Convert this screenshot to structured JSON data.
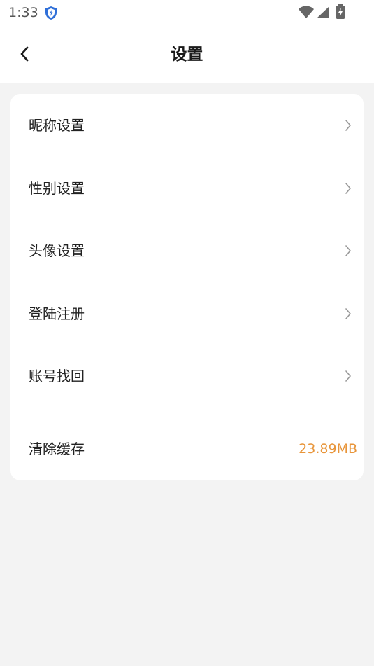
{
  "status_bar": {
    "time": "1:33",
    "icons": [
      "shield-icon",
      "wifi-icon",
      "signal-icon",
      "battery-icon"
    ]
  },
  "header": {
    "back_icon": "chevron-left-icon",
    "title": "设置"
  },
  "settings": {
    "items": [
      {
        "label": "昵称设置",
        "icon": "chevron-right-icon"
      },
      {
        "label": "性别设置",
        "icon": "chevron-right-icon"
      },
      {
        "label": "头像设置",
        "icon": "chevron-right-icon"
      },
      {
        "label": "登陆注册",
        "icon": "chevron-right-icon"
      },
      {
        "label": "账号找回",
        "icon": "chevron-right-icon"
      }
    ],
    "clear_cache": {
      "label": "清除缓存",
      "value": "23.89MB"
    }
  },
  "colors": {
    "background": "#f3f3f3",
    "card": "#ffffff",
    "accent": "#e8953a"
  }
}
